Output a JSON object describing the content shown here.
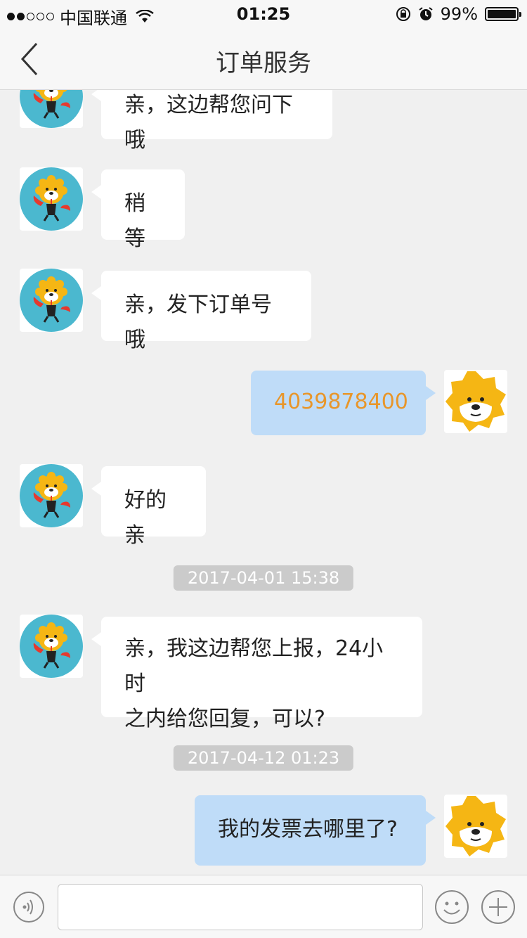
{
  "status_bar": {
    "carrier": "中国联通",
    "time": "01:25",
    "battery": "99%",
    "battery_level": 0.99,
    "icons": [
      "signal-dots-icon",
      "wifi-icon",
      "orientation-lock-icon",
      "alarm-icon",
      "battery-icon"
    ]
  },
  "header": {
    "title": "订单服务",
    "back_icon": "chevron-left-icon"
  },
  "messages": [
    {
      "side": "left",
      "sender": "service",
      "text": "亲，这边帮您问下哦"
    },
    {
      "side": "left",
      "sender": "service",
      "text": "稍等"
    },
    {
      "side": "left",
      "sender": "service",
      "text": "亲，发下订单号哦"
    },
    {
      "side": "right",
      "sender": "user",
      "text": "4039878400",
      "color": "#e8962a"
    },
    {
      "side": "left",
      "sender": "service",
      "text": "好的亲"
    },
    {
      "type": "timestamp",
      "text": "2017-04-01 15:38"
    },
    {
      "side": "left",
      "sender": "service",
      "lines": [
        "亲，我这边帮您上报，24小时",
        "之内给您回复，可以?"
      ]
    },
    {
      "type": "timestamp",
      "text": "2017-04-12 01:23"
    },
    {
      "side": "right",
      "sender": "user",
      "text": "我的发票去哪里了?"
    }
  ],
  "input_bar": {
    "value": "",
    "placeholder": "",
    "icons": [
      "voice-icon",
      "emoji-icon",
      "plus-icon"
    ]
  },
  "colors": {
    "user_bubble": "#bfdcf8",
    "service_bubble": "#ffffff",
    "lion_yellow": "#f5b614",
    "avatar_teal": "#4bb8cf",
    "order_number": "#e8962a"
  }
}
